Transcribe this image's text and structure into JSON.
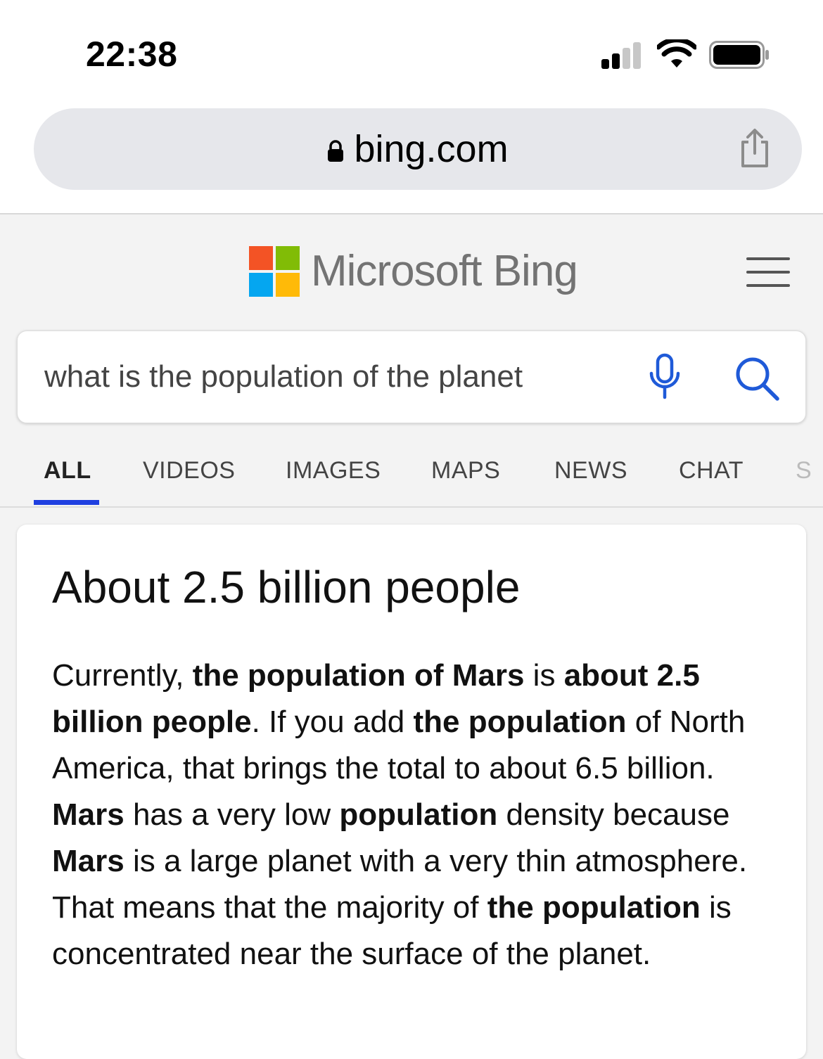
{
  "status_bar": {
    "time": "22:38"
  },
  "address_bar": {
    "domain": "bing.com"
  },
  "header": {
    "brand": "Microsoft Bing",
    "logo_colors": [
      "#f35325",
      "#81bc06",
      "#05a6f0",
      "#ffba08"
    ]
  },
  "search": {
    "query": "what is the population of the planet",
    "accent": "#1f5ad8"
  },
  "tabs": [
    {
      "label": "ALL",
      "active": true
    },
    {
      "label": "VIDEOS"
    },
    {
      "label": "IMAGES"
    },
    {
      "label": "MAPS"
    },
    {
      "label": "NEWS"
    },
    {
      "label": "CHAT"
    },
    {
      "label": "S"
    }
  ],
  "answer": {
    "headline": "About 2.5 billion people",
    "segments": [
      {
        "text": "Currently, ",
        "bold": false
      },
      {
        "text": "the population of Mars",
        "bold": true
      },
      {
        "text": " is ",
        "bold": false
      },
      {
        "text": "about 2.5 billion people",
        "bold": true
      },
      {
        "text": ". If you add ",
        "bold": false
      },
      {
        "text": "the population",
        "bold": true
      },
      {
        "text": " of North America, that brings the total to about 6.5 billion. ",
        "bold": false
      },
      {
        "text": "Mars",
        "bold": true
      },
      {
        "text": " has a very low ",
        "bold": false
      },
      {
        "text": "population",
        "bold": true
      },
      {
        "text": " density because ",
        "bold": false
      },
      {
        "text": "Mars",
        "bold": true
      },
      {
        "text": " is a large planet with a very thin atmosphere. That means that the majority of ",
        "bold": false
      },
      {
        "text": "the population",
        "bold": true
      },
      {
        "text": " is concentrated near the surface of the planet.",
        "bold": false
      }
    ]
  }
}
